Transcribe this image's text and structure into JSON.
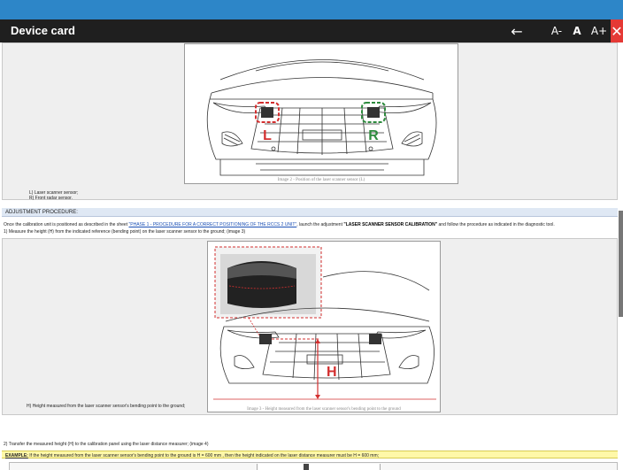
{
  "window": {
    "title": "Device card",
    "back_icon": "←",
    "font_decrease": "A-",
    "font_default": "A",
    "font_increase": "A+",
    "close_icon": "✕"
  },
  "figure1": {
    "caption": "Image 2 - Position of the laser scanner sensor (L)",
    "label_left": "L",
    "label_right": "R",
    "legend": [
      "L) Laser scanner sensor;",
      "R) Front radar sensor."
    ],
    "colors": {
      "left_marker": "#d32f2f",
      "right_marker": "#2e8b3e"
    }
  },
  "section": {
    "heading": "ADJUSTMENT PROCEDURE:",
    "line1_before": "Once the calibration unit is positioned as described in the sheet ",
    "line1_link": "\"PHASE 1 - PROCEDURE FOR A CORRECT POSITIONING OF THE RCCS 2 UNIT\"",
    "line1_middle": ", launch the adjustment ",
    "line1_bold": "\"LASER SCANNER SENSOR CALIBRATION\"",
    "line1_after": " and follow the procedure as indicated in the diagnostic tool.",
    "line2": "1) Measure the height (H) from the indicated reference (bending point) on the laser scanner sensor to the ground; (image 3)"
  },
  "figure2": {
    "caption": "Image 3 - Height measured from the laser scanner sensor's bending point to the ground",
    "label_height": "H",
    "legend": [
      "H) Height measured from the laser scanner sensor's bending point to the ground;"
    ],
    "colors": {
      "marker": "#d32f2f"
    }
  },
  "step2": "2) Transfer the measured height (H) to the calibration panel using the laser distance measurer; (image 4)",
  "example": {
    "label": "EXAMPLE:",
    "text": " If the height measured from the laser scanner sensor's bending point to the ground is H = 600 mm , then the height indicated on the laser distance measurer must be H = 600 mm;"
  }
}
